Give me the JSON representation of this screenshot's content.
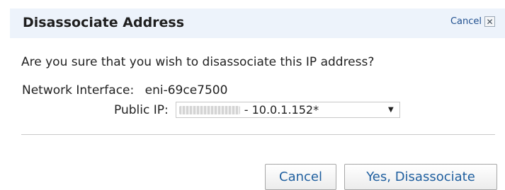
{
  "dialog": {
    "title": "Disassociate Address",
    "header_cancel_label": "Cancel",
    "close_icon_glyph": "✕",
    "question": "Are you sure that you wish to disassociate this IP address?",
    "network_interface": {
      "label": "Network Interface:",
      "value": "eni-69ce7500"
    },
    "public_ip": {
      "label": "Public IP:",
      "selected_value_visible": "- 10.0.1.152*",
      "arrow_icon": "▼"
    },
    "buttons": {
      "cancel": "Cancel",
      "confirm": "Yes, Disassociate"
    }
  },
  "colors": {
    "header_bg": "#edf3fb",
    "link_blue": "#1f4f8f",
    "button_text": "#1f5f9f"
  }
}
